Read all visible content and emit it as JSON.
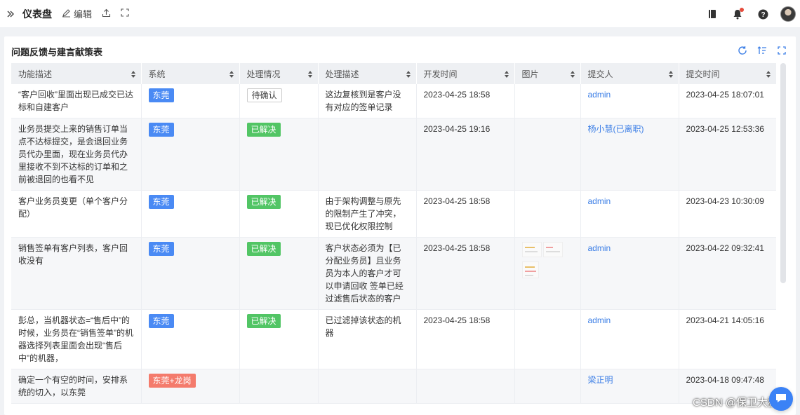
{
  "topbar": {
    "title": "仪表盘",
    "edit_label": "编辑"
  },
  "panel": {
    "title": "问题反馈与建言献策表"
  },
  "table": {
    "columns": [
      "功能描述",
      "系统",
      "处理情况",
      "处理描述",
      "开发时间",
      "图片",
      "提交人",
      "提交时间"
    ],
    "rows": [
      {
        "desc": "“客户回收”里面出现已成交已达标和自建客户",
        "system": "东莞",
        "status": "待确认",
        "handling": "这边复核到是客户没有对应的签单记录",
        "dev_time": "2023-04-25 18:58",
        "has_image": false,
        "submitter": "admin",
        "submit_time": "2023-04-25 18:07:01"
      },
      {
        "desc": "业务员提交上来的销售订单当点不达标提交，是会退回业务员代办里面，现在业务员代办里接收不到不达标的订单和之前被退回的也看不见",
        "system": "东莞",
        "status": "已解决",
        "handling": "",
        "dev_time": "2023-04-25 19:16",
        "has_image": false,
        "submitter": "杨小慧(已离职)",
        "submit_time": "2023-04-25 12:53:36"
      },
      {
        "desc": "客户业务员变更（单个客户分配）",
        "system": "东莞",
        "status": "已解决",
        "handling": "由于架构调整与原先的限制产生了冲突，现已优化权限控制",
        "dev_time": "2023-04-25 18:58",
        "has_image": false,
        "submitter": "admin",
        "submit_time": "2023-04-23 10:30:09"
      },
      {
        "desc": "销售签单有客户列表，客户回收没有",
        "system": "东莞",
        "status": "已解决",
        "handling": "客户状态必须为【已分配业务员】且业务员为本人的客户才可以申请回收 签单已经过滤售后状态的客户",
        "dev_time": "2023-04-25 18:58",
        "has_image": true,
        "submitter": "admin",
        "submit_time": "2023-04-22 09:32:41"
      },
      {
        "desc": "彭总，当机器状态=“售后中”的时候，业务员在“销售签单”的机器选择列表里面会出现“售后中”的机器，",
        "system": "东莞",
        "status": "已解决",
        "handling": "已过滤掉该状态的机器",
        "dev_time": "2023-04-25 18:58",
        "has_image": false,
        "submitter": "admin",
        "submit_time": "2023-04-21 14:05:16"
      },
      {
        "desc": "确定一个有空的时间，安排系统的切入，以东莞",
        "system": "东莞+龙岗",
        "status": "",
        "handling": "",
        "dev_time": "",
        "has_image": false,
        "submitter": "梁正明",
        "submit_time": "2023-04-18 09:47:48"
      }
    ]
  },
  "watermark": "CSDN @保卫大狮兄",
  "colors": {
    "tag_blue": "#4a8af4",
    "tag_green": "#52c565",
    "tag_red": "#f47b6c",
    "link": "#3b7ee6",
    "header_bg": "#eef0f3"
  },
  "icons": [
    "expand-sidebar-icon",
    "edit-icon",
    "share-icon",
    "fullscreen-icon",
    "book-icon",
    "bell-icon",
    "help-icon",
    "refresh-icon",
    "sort-icon",
    "fullscreen-icon",
    "chat-icon"
  ]
}
